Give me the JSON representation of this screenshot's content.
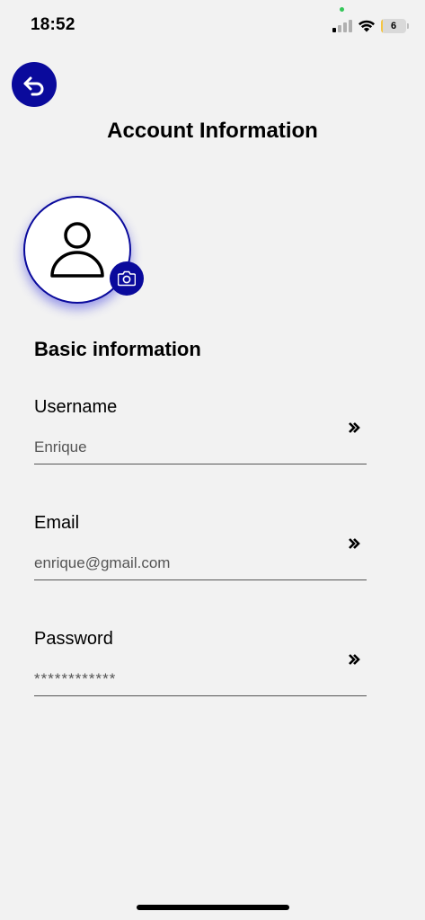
{
  "status_bar": {
    "time": "18:52",
    "battery": "6",
    "battery_level": 0.06
  },
  "header": {
    "back_icon": "undo-arrow-icon",
    "title": "Account Information"
  },
  "profile": {
    "avatar_icon": "user-icon",
    "camera_icon": "camera-icon"
  },
  "basic_info": {
    "title": "Basic information",
    "fields": [
      {
        "label": "Username",
        "value": "Enrique"
      },
      {
        "label": "Email",
        "value": "enrique@gmail.com"
      },
      {
        "label": "Password",
        "value": "************"
      }
    ],
    "chevron_icon": "double-chevron-right-icon"
  },
  "colors": {
    "accent": "#0a0a9c",
    "background": "#f2f2f2"
  }
}
